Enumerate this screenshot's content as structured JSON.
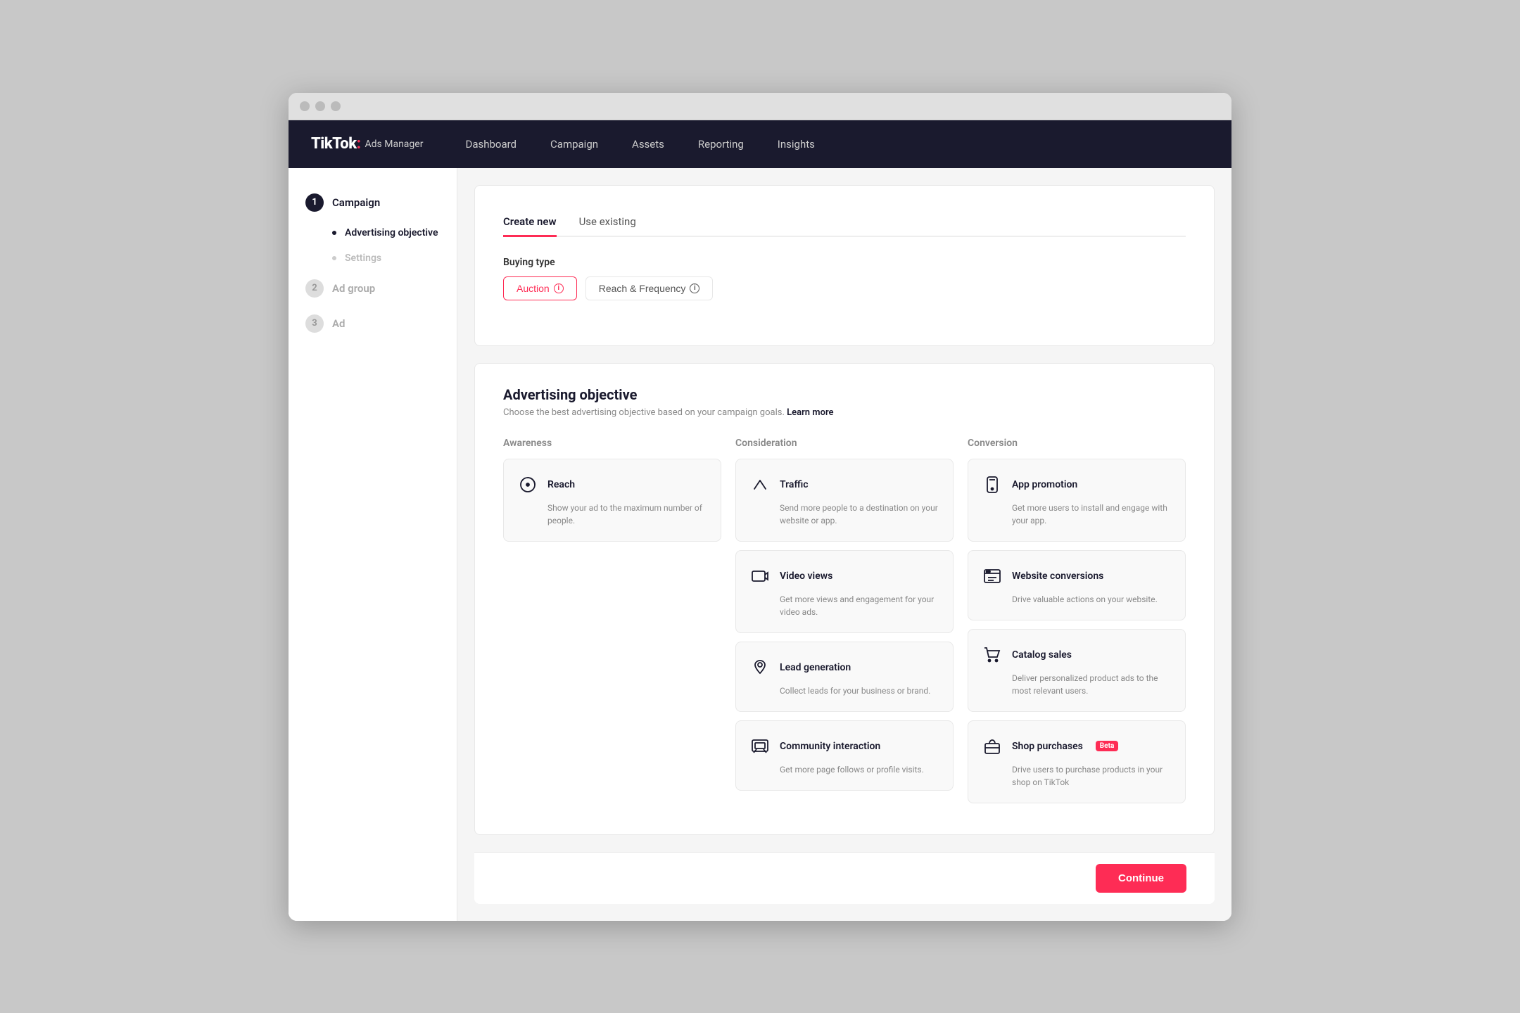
{
  "browser": {
    "dots": [
      "dot1",
      "dot2",
      "dot3"
    ]
  },
  "nav": {
    "logo": "TikTok",
    "logo_colon": ":",
    "logo_sub": "Ads Manager",
    "items": [
      {
        "label": "Dashboard",
        "id": "dashboard"
      },
      {
        "label": "Campaign",
        "id": "campaign"
      },
      {
        "label": "Assets",
        "id": "assets"
      },
      {
        "label": "Reporting",
        "id": "reporting"
      },
      {
        "label": "Insights",
        "id": "insights"
      }
    ]
  },
  "sidebar": {
    "steps": [
      {
        "number": "1",
        "label": "Campaign",
        "active": true
      },
      {
        "sub_items": [
          {
            "label": "Advertising objective",
            "active": true
          },
          {
            "label": "Settings",
            "active": false
          }
        ]
      },
      {
        "number": "2",
        "label": "Ad group",
        "active": false
      },
      {
        "number": "3",
        "label": "Ad",
        "active": false
      }
    ]
  },
  "content": {
    "tabs": [
      {
        "label": "Create new",
        "active": true
      },
      {
        "label": "Use existing",
        "active": false
      }
    ],
    "buying_type": {
      "label": "Buying type",
      "options": [
        {
          "label": "Auction",
          "active": true
        },
        {
          "label": "Reach & Frequency",
          "active": false
        }
      ]
    },
    "advertising_objective": {
      "title": "Advertising objective",
      "desc": "Choose the best advertising objective based on your campaign goals.",
      "learn_more": "Learn more",
      "columns": [
        {
          "label": "Awareness",
          "objectives": [
            {
              "title": "Reach",
              "desc": "Show your ad to the maximum number of people.",
              "icon": "reach"
            }
          ]
        },
        {
          "label": "Consideration",
          "objectives": [
            {
              "title": "Traffic",
              "desc": "Send more people to a destination on your website or app.",
              "icon": "traffic"
            },
            {
              "title": "Video views",
              "desc": "Get more views and engagement for your video ads.",
              "icon": "video"
            },
            {
              "title": "Lead generation",
              "desc": "Collect leads for your business or brand.",
              "icon": "lead"
            },
            {
              "title": "Community interaction",
              "desc": "Get more page follows or profile visits.",
              "icon": "community"
            }
          ]
        },
        {
          "label": "Conversion",
          "objectives": [
            {
              "title": "App promotion",
              "desc": "Get more users to install and engage with your app.",
              "icon": "app"
            },
            {
              "title": "Website conversions",
              "desc": "Drive valuable actions on your website.",
              "icon": "website"
            },
            {
              "title": "Catalog sales",
              "desc": "Deliver personalized product ads to the most relevant users.",
              "icon": "catalog"
            },
            {
              "title": "Shop purchases",
              "beta": true,
              "desc": "Drive users to purchase products in your shop on TikTok",
              "icon": "shop"
            }
          ]
        }
      ]
    }
  },
  "footer": {
    "continue_label": "Continue"
  }
}
